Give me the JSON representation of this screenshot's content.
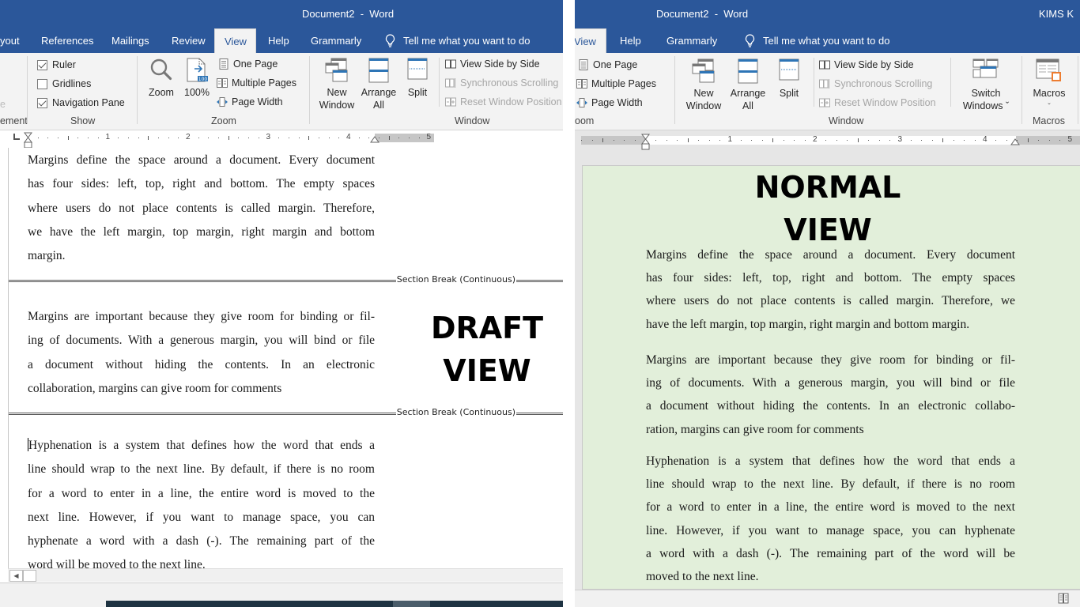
{
  "left_window": {
    "title": "Document2  -  Word",
    "tabs": [
      {
        "label": "yout",
        "active": false
      },
      {
        "label": "References",
        "active": false
      },
      {
        "label": "Mailings",
        "active": false
      },
      {
        "label": "Review",
        "active": false
      },
      {
        "label": "View",
        "active": true
      },
      {
        "label": "Help",
        "active": false
      },
      {
        "label": "Grammarly",
        "active": false
      }
    ],
    "tell_me": "Tell me what you want to do",
    "ribbon": {
      "partial_group_label": "ement",
      "partial_item": "e",
      "show": {
        "label": "Show",
        "ruler": {
          "label": "Ruler",
          "checked": true
        },
        "gridlines": {
          "label": "Gridlines",
          "checked": false
        },
        "navigation_pane": {
          "label": "Navigation Pane",
          "checked": true
        }
      },
      "zoom": {
        "label": "Zoom",
        "zoom_button": "Zoom",
        "hundred_button": "100%",
        "hundred_badge": "100",
        "one_page": "One Page",
        "multiple_pages": "Multiple Pages",
        "page_width": "Page Width"
      },
      "window": {
        "label": "Window",
        "new_window": [
          "New",
          "Window"
        ],
        "arrange_all": [
          "Arrange",
          "All"
        ],
        "split": "Split",
        "view_side_by_side": "View Side by Side",
        "synchronous_scrolling": "Synchronous Scrolling",
        "reset_window_position": "Reset Window Position"
      }
    },
    "ruler_numbers": [
      "1",
      "2",
      "3",
      "4",
      "5"
    ],
    "view_label": [
      "DRAFT",
      "VIEW"
    ],
    "section_break_label": "Section Break (Continuous)",
    "paragraphs": [
      [
        "Margins define the space around a document. Every document",
        "has four sides: left, top, right and bottom. The empty spaces",
        "where users do not place contents is called margin. Therefore,",
        "we have the left margin, top margin, right margin and bottom",
        "margin."
      ],
      [
        "Margins are important because they give room for binding or fil-",
        "ing of documents. With a generous margin, you will bind or file",
        "a document without hiding the contents. In an electronic",
        "collaboration, margins can give room for comments"
      ],
      [
        "Hyphenation is a system that defines how the word that ends a",
        "line should wrap to the next line. By default, if there is no room",
        "for a word to enter in a line, the entire word is moved to the",
        "next line. However, if you want to manage space, you can",
        "hyphenate a word with a dash (-). The remaining part of the",
        "word will be moved to the next line."
      ]
    ]
  },
  "right_window": {
    "title": "Document2  -  Word",
    "user": "KIMS K",
    "tabs": [
      {
        "label": "View",
        "active": true
      },
      {
        "label": "Help",
        "active": false
      },
      {
        "label": "Grammarly",
        "active": false
      }
    ],
    "tell_me": "Tell me what you want to do",
    "ribbon": {
      "zoom": {
        "label": "oom",
        "one_page": "One Page",
        "multiple_pages": "Multiple Pages",
        "page_width": "Page Width"
      },
      "window": {
        "label": "Window",
        "new_window": [
          "New",
          "Window"
        ],
        "arrange_all": [
          "Arrange",
          "All"
        ],
        "split": "Split",
        "view_side_by_side": "View Side by Side",
        "synchronous_scrolling": "Synchronous Scrolling",
        "reset_window_position": "Reset Window Position",
        "switch_windows": [
          "Switch",
          "Windows ˇ"
        ]
      },
      "macros": {
        "label": "Macros",
        "macros_button": "Macros",
        "dropdown": "ˇ"
      }
    },
    "ruler_numbers": [
      "1",
      "2",
      "3",
      "4",
      "5"
    ],
    "view_label": [
      "NORMAL",
      "VIEW"
    ],
    "page_color": "#e2efda",
    "paragraphs": [
      [
        "Margins define the space around a document. Every document",
        "has four sides: left, top, right and bottom. The empty spaces",
        "where users do not place contents is called margin. Therefore, we",
        "have the left margin, top margin, right margin and bottom margin."
      ],
      [
        "Margins are important because they give room for binding or fil-",
        "ing of documents. With a generous margin, you will bind or file",
        "a document without hiding the contents. In an electronic collabo-",
        "ration, margins can give room for comments"
      ],
      [
        "Hyphenation is a system that defines how the word that ends a",
        "line should wrap to the next line. By default, if there is no room",
        "for a word to enter in a line, the entire word is moved to the next",
        "line. However, if you want to manage space, you can hyphenate",
        "a word with a dash (-). The remaining part of the word will be",
        "moved to the next line."
      ]
    ]
  },
  "colors": {
    "title_bar": "#2b579a",
    "ribbon_bg": "#f3f3f3",
    "page_green": "#e2efda"
  }
}
